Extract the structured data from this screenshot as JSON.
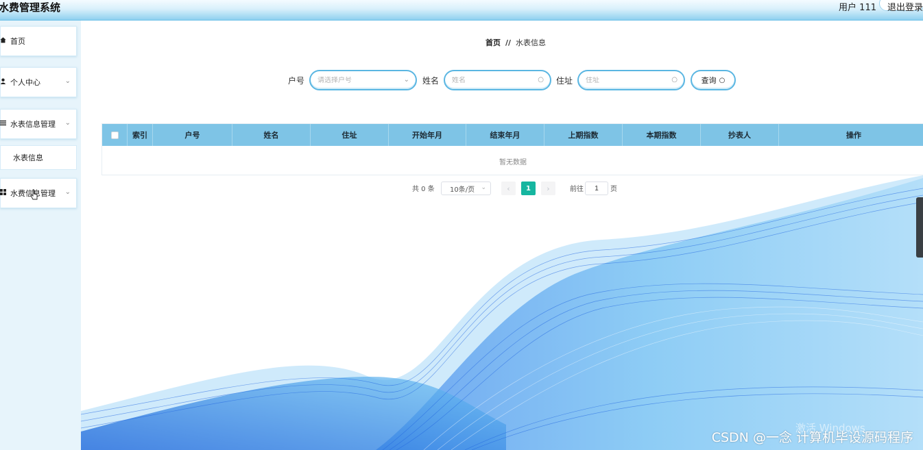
{
  "header": {
    "title": "水费管理系统",
    "user_label": "用户 111",
    "logout_label": "退出登录"
  },
  "sidebar": {
    "items": [
      {
        "label": "首页",
        "icon": "home-icon"
      },
      {
        "label": "个人中心",
        "icon": "user-icon"
      },
      {
        "label": "水表信息管理",
        "icon": "list-icon"
      },
      {
        "label": "水表信息",
        "icon": ""
      },
      {
        "label": "水费信息管理",
        "icon": "grid-icon"
      }
    ]
  },
  "breadcrumb": {
    "home": "首页",
    "separator": "//",
    "current": "水表信息"
  },
  "filters": {
    "account_label": "户号",
    "account_placeholder": "请选择户号",
    "name_label": "姓名",
    "name_placeholder": "姓名",
    "address_label": "住址",
    "address_placeholder": "住址",
    "query_label": "查询"
  },
  "table": {
    "columns": [
      "索引",
      "户号",
      "姓名",
      "住址",
      "开始年月",
      "结束年月",
      "上期指数",
      "本期指数",
      "抄表人",
      "操作"
    ],
    "empty_text": "暂无数据",
    "header_color": "#7ec4e6"
  },
  "pagination": {
    "total_text": "共 0 条",
    "page_size": "10条/页",
    "current_page": "1",
    "goto_label": "前往",
    "goto_value": "1",
    "page_suffix": "页",
    "active_color": "#16b6a0"
  },
  "overlay": {
    "watermark": "CSDN @一念 计算机毕设源码程序",
    "activate_windows": "激活 Windows"
  }
}
